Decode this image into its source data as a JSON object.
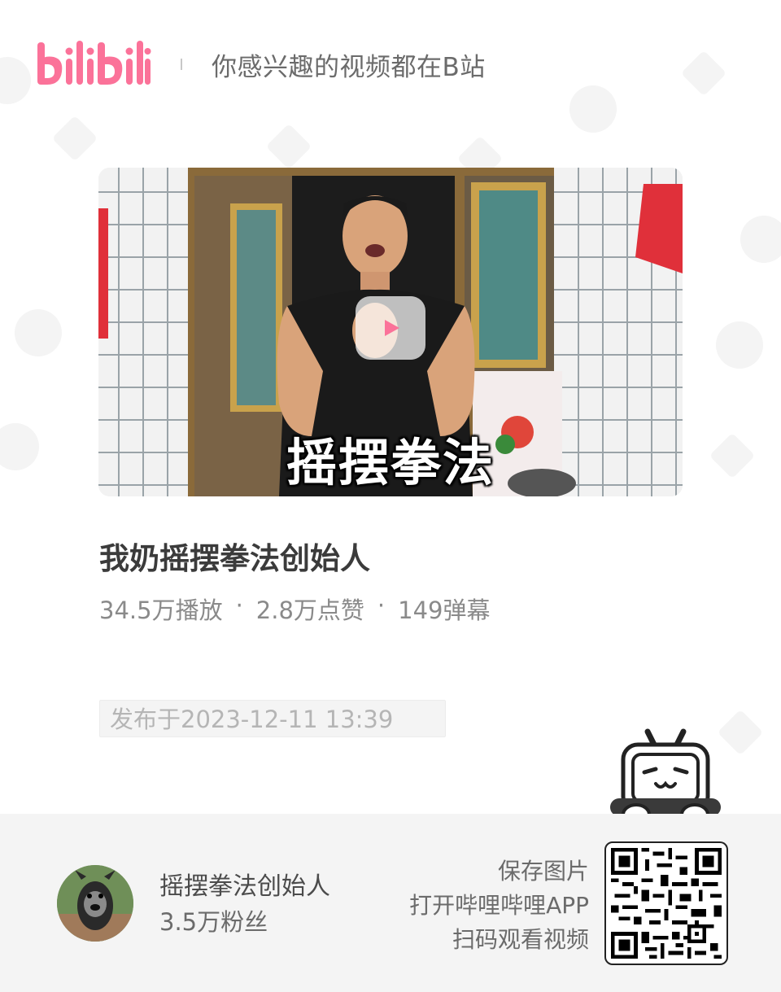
{
  "header": {
    "logo_text": "bilibili",
    "slogan": "你感兴趣的视频都在B站"
  },
  "video": {
    "cover_caption": "摇摆拳法",
    "title": "我奶摇摆拳法创始人",
    "stats": {
      "views": "34.5万播放",
      "likes": "2.8万点赞",
      "danmaku": "149弹幕",
      "separator": "·"
    },
    "publish_date": "发布于2023-12-11 13:39"
  },
  "uploader": {
    "name": "摇摆拳法创始人",
    "fans": "3.5万粉丝"
  },
  "qr": {
    "line1": "保存图片",
    "line2": "打开哔哩哔哩APP",
    "line3": "扫码观看视频"
  },
  "colors": {
    "brand_pink": "#fb7299",
    "footer_bg": "#f4f4f4"
  },
  "icons": [
    "bilibili-logo",
    "play-icon",
    "tv-mascot-icon",
    "qr-code"
  ]
}
